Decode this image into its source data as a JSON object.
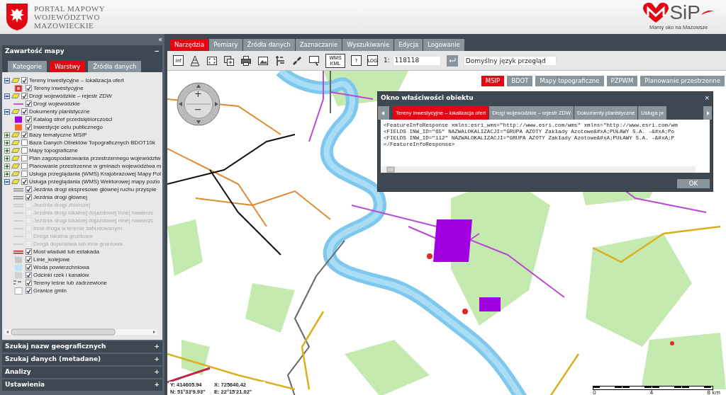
{
  "header": {
    "title_lines": [
      "PORTAL MAPOWY",
      "WOJEWÓDZTWO",
      "MAZOWIECKIE"
    ],
    "logo_text": "SiP",
    "slogan": "Mamy oko na Mazowsze"
  },
  "sidebar": {
    "collapse": "«",
    "panel": {
      "title": "Zawartość mapy",
      "toggle": "−",
      "tabs": [
        {
          "label": "Kategorie",
          "selected": false
        },
        {
          "label": "Warstwy",
          "selected": true
        },
        {
          "label": "Źródła danych",
          "selected": false
        }
      ],
      "layers": [
        {
          "label": "Tereny inwestycyjne – lokalizacja ofert",
          "checked": true,
          "expanded": true,
          "children": [
            {
              "label": "Tereny inwestycyjne",
              "checked": true,
              "disabled": false,
              "kind": "box",
              "color": "#e8262a"
            }
          ]
        },
        {
          "label": "Drogi wojewódzkie – rejestr ZDW",
          "checked": true,
          "expanded": true,
          "children": [
            {
              "label": "Drogi wojewódzkie",
              "checked": true,
              "disabled": false,
              "kind": "line",
              "color": "#c05ad0"
            }
          ]
        },
        {
          "label": "Dokumenty planistyczne",
          "checked": true,
          "expanded": true,
          "children": [
            {
              "label": "Katalog stref przedsiębiorczości",
              "checked": true,
              "disabled": false,
              "kind": "fill",
              "color": "#a100e0"
            },
            {
              "label": "Inwestycje celu publicznego",
              "checked": true,
              "disabled": false,
              "kind": "fill",
              "color": "#ff6a1a"
            }
          ]
        },
        {
          "label": "Bazy tematyczne MSIP",
          "checked": true,
          "expanded": false
        },
        {
          "label": "Baza Danych Obiektów Topograficznych BDOT10k",
          "checked": false,
          "expanded": false
        },
        {
          "label": "Mapy topograficzne",
          "checked": false,
          "expanded": false
        },
        {
          "label": "Plan zagospodarowania przestrzennego województw",
          "checked": false,
          "expanded": false
        },
        {
          "label": "Planowanie przestrzenne w gminach województwa m",
          "checked": false,
          "expanded": false
        },
        {
          "label": "Usługa przeglądania (WMS) Krajobrazowej Mapy Pol",
          "checked": false,
          "expanded": false
        },
        {
          "label": "Usługa przeglądania (WMS) Wektorowej mapy pozio",
          "checked": true,
          "expanded": true,
          "children": [
            {
              "label": "Jezdnia drogi ekspresowe głównej ruchu przyspie",
              "checked": true,
              "disabled": false,
              "kind": "double",
              "color": "#8a8a8a"
            },
            {
              "label": "Jezdnia drogi głównej",
              "checked": true,
              "disabled": false,
              "kind": "double",
              "color": "#8a8a8a"
            },
            {
              "label": "Jezdnia drogi zbiorczej",
              "checked": false,
              "disabled": true,
              "kind": "double",
              "color": "#c8c8c8"
            },
            {
              "label": "Jezdnia drogi lokalnej dojazdowej innej nawierzc",
              "checked": false,
              "disabled": true,
              "kind": "line",
              "color": "#cfcfcf"
            },
            {
              "label": "Jezdnia drogi lokalnej dojazdowej innej nawierzc",
              "checked": false,
              "disabled": true,
              "kind": "line",
              "color": "#cfcfcf"
            },
            {
              "label": "Inna droga w terenie zabudowanym",
              "checked": false,
              "disabled": true,
              "kind": "line",
              "color": "#cfcfcf"
            },
            {
              "label": "Droga lokalna gruntowa",
              "checked": false,
              "disabled": true,
              "kind": "line",
              "color": "#cfcfcf"
            },
            {
              "label": "Droga dojazdowa lub inna gruntowa",
              "checked": false,
              "disabled": true,
              "kind": "line",
              "color": "#cfcfcf"
            },
            {
              "label": "Most wiadukt lub estakada",
              "checked": true,
              "disabled": false,
              "kind": "double",
              "color": "#b02020"
            },
            {
              "label": "Linie_kolejowe",
              "checked": true,
              "disabled": false,
              "kind": "fill",
              "color": "#c8c8c8"
            },
            {
              "label": "Woda powierzchniowa",
              "checked": true,
              "disabled": false,
              "kind": "fill",
              "color": "#bfe4f7"
            },
            {
              "label": "Odcinki rzek i kanałów",
              "checked": true,
              "disabled": false,
              "kind": "fill",
              "color": "#d0d0d0"
            },
            {
              "label": "Tereny leśne lub zadrzewione",
              "checked": true,
              "disabled": false,
              "kind": "dash",
              "color": "#888888"
            },
            {
              "label": "Granice gmin",
              "checked": true,
              "disabled": false,
              "kind": "box",
              "color": "#ffffff"
            }
          ]
        }
      ]
    },
    "sections": [
      {
        "title": "Szukaj nazw geograficznych",
        "toggle": "+"
      },
      {
        "title": "Szukaj danych (metadane)",
        "toggle": "+"
      },
      {
        "title": "Analizy",
        "toggle": "+"
      },
      {
        "title": "Ustawienia",
        "toggle": "+"
      }
    ]
  },
  "tabs": [
    {
      "label": "Narzędzia",
      "selected": true
    },
    {
      "label": "Pomiary",
      "selected": false
    },
    {
      "label": "Źródła danych",
      "selected": false
    },
    {
      "label": "Zaznaczanie",
      "selected": false
    },
    {
      "label": "Wyszukiwanie",
      "selected": false
    },
    {
      "label": "Edycja",
      "selected": false
    },
    {
      "label": "Logowanie",
      "selected": false
    }
  ],
  "toolbar": {
    "tools": [
      {
        "kind": "text",
        "label": "Inf"
      },
      {
        "kind": "cone"
      },
      {
        "kind": "extent"
      },
      {
        "kind": "add"
      },
      {
        "kind": "print"
      },
      {
        "kind": "image"
      },
      {
        "kind": "legend"
      },
      {
        "kind": "link"
      },
      {
        "kind": "screen"
      },
      {
        "kind": "text2",
        "label": "WMS KML"
      },
      {
        "kind": "text",
        "label": "?"
      },
      {
        "kind": "text",
        "label": "LOG"
      }
    ],
    "scale_prefix": "1:",
    "scale": "118118",
    "language": "Domyślny język przegląd"
  },
  "basemaps": [
    {
      "label": "MSIP",
      "selected": true
    },
    {
      "label": "BDOT",
      "selected": false
    },
    {
      "label": "Mapy topograficzne",
      "selected": false
    },
    {
      "label": "PZPWM",
      "selected": false
    },
    {
      "label": "Planowanie przestrzenne",
      "selected": false
    }
  ],
  "dialog": {
    "title": "Okno właściwości obiektu",
    "close": "×",
    "tabs": [
      {
        "label": "Tereny inwestycyjne – lokalizacja ofert",
        "selected": true
      },
      {
        "label": "Drogi wojewódzkie – rejestr ZDW",
        "selected": false
      },
      {
        "label": "Dokumenty planistyczne",
        "selected": false
      },
      {
        "label": "Usługa pr",
        "selected": false
      }
    ],
    "lines": [
      "<FeatureInfoResponse xmlns:esri_wms=\"http://www.esri.com/wms\" xmlns=\"http://www.esri.com/wm",
      "<FIELDS INW_ID=\"65\" NAZWALOKALIZACJI=\"GRUPA AZOTY Zakłady Azotowe&#xA;PUŁAWY S.A. -&#xA;Po",
      "<FIELDS INW_ID=\"112\" NAZWALOKALIZACJI=\"GRUPA AZOTY Zakłady Azotowe&#xA;PUŁAWY S.A. -&#xA;P",
      "</FeatureInfoResponse>"
    ],
    "ok": "OK"
  },
  "map": {
    "zoom_in": "+",
    "zoom_out": "−",
    "coords": [
      "Y: 414605.94",
      "X: 725640.42",
      "N: 51°33'9.93\"",
      "E: 22°15'21.02\""
    ],
    "scale_labels": [
      "0",
      "4",
      "8 km"
    ]
  }
}
